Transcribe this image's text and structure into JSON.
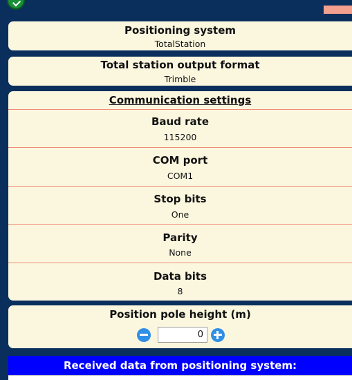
{
  "positioning_system": {
    "label": "Positioning system",
    "value": "TotalStation"
  },
  "output_format": {
    "label": "Total station output format",
    "value": "Trimble"
  },
  "communication": {
    "title": "Communication settings",
    "baud_rate": {
      "label": "Baud rate",
      "value": "115200"
    },
    "com_port": {
      "label": "COM port",
      "value": "COM1"
    },
    "stop_bits": {
      "label": "Stop bits",
      "value": "One"
    },
    "parity": {
      "label": "Parity",
      "value": "None"
    },
    "data_bits": {
      "label": "Data bits",
      "value": "8"
    }
  },
  "pole_height": {
    "label": "Position pole height (m)",
    "value": "0"
  },
  "received": {
    "title": "Received data from positioning system:"
  },
  "colors": {
    "background": "#0b2f5c",
    "card": "#fbf7df",
    "divider": "#f08a78",
    "header_blue": "#0000ff",
    "button_blue": "#2f8fe6"
  }
}
